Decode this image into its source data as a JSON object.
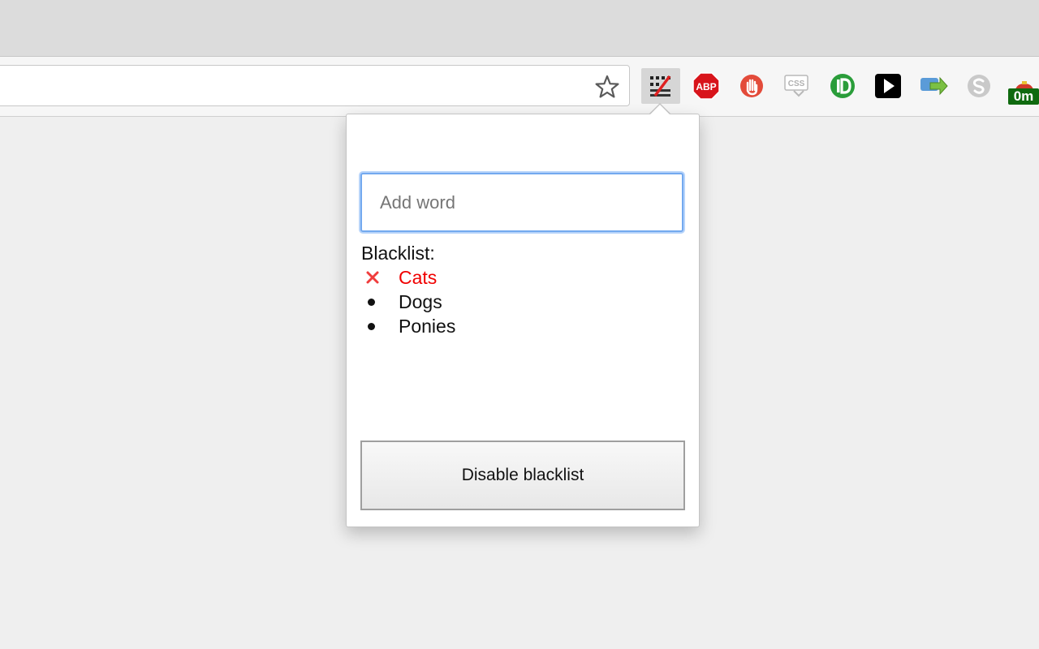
{
  "toolbar": {
    "bookmark_icon": "star-outline-icon",
    "extensions": [
      {
        "id": "blacklist",
        "icon": "word-blacklist-icon",
        "active": true
      },
      {
        "id": "adblock",
        "icon": "abp-icon",
        "label": "ABP",
        "color": "#d8141b"
      },
      {
        "id": "stop",
        "icon": "stop-hand-icon",
        "color": "#e34b3a"
      },
      {
        "id": "css",
        "icon": "css-viewer-icon",
        "label": "CSS"
      },
      {
        "id": "id",
        "icon": "green-id-icon",
        "color": "#2a9d3a"
      },
      {
        "id": "play",
        "icon": "play-icon",
        "color": "#000000"
      },
      {
        "id": "share",
        "icon": "arrow-share-icon"
      },
      {
        "id": "skype",
        "icon": "skype-icon"
      },
      {
        "id": "timer",
        "icon": "timer-icon",
        "badge": "0m",
        "badge_color": "#0f6a0f"
      }
    ]
  },
  "popup": {
    "input_placeholder": "Add word",
    "input_value": "",
    "list_title": "Blacklist:",
    "items": [
      {
        "label": "Cats",
        "state": "hover-remove"
      },
      {
        "label": "Dogs",
        "state": "normal"
      },
      {
        "label": "Ponies",
        "state": "normal"
      }
    ],
    "disable_button_label": "Disable blacklist",
    "accent_focus_color": "#73a9ef",
    "remove_color": "#f03c3c"
  }
}
